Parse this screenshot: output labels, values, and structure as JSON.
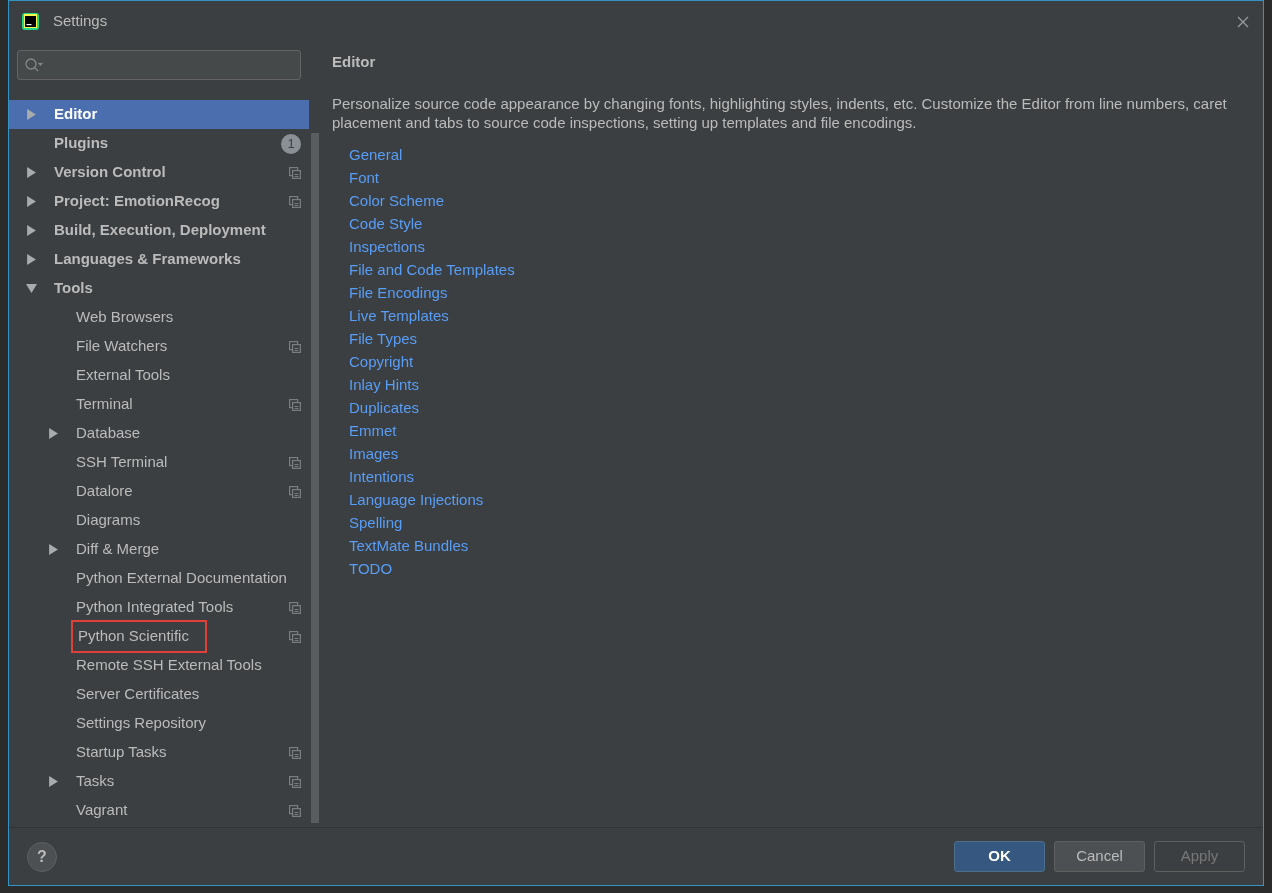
{
  "window": {
    "title": "Settings"
  },
  "sidebar": {
    "items": [
      {
        "label": "Editor",
        "expanded": false,
        "selected": true,
        "project_scoped": false
      },
      {
        "label": "Plugins",
        "selected": false,
        "badge": "1"
      },
      {
        "label": "Version Control",
        "expanded": false,
        "selected": false,
        "project_scoped": true
      },
      {
        "label": "Project: EmotionRecog",
        "expanded": false,
        "selected": false,
        "project_scoped": true
      },
      {
        "label": "Build, Execution, Deployment",
        "expanded": false,
        "selected": false,
        "project_scoped": false
      },
      {
        "label": "Languages & Frameworks",
        "expanded": false,
        "selected": false,
        "project_scoped": false
      },
      {
        "label": "Tools",
        "expanded": true,
        "selected": false,
        "project_scoped": false,
        "children": [
          {
            "label": "Web Browsers",
            "selected": false,
            "project_scoped": false
          },
          {
            "label": "File Watchers",
            "selected": false,
            "project_scoped": true
          },
          {
            "label": "External Tools",
            "selected": false,
            "project_scoped": false
          },
          {
            "label": "Terminal",
            "selected": false,
            "project_scoped": true
          },
          {
            "label": "Database",
            "expanded": false,
            "selected": false,
            "project_scoped": false
          },
          {
            "label": "SSH Terminal",
            "selected": false,
            "project_scoped": true
          },
          {
            "label": "Datalore",
            "selected": false,
            "project_scoped": true
          },
          {
            "label": "Diagrams",
            "selected": false,
            "project_scoped": false
          },
          {
            "label": "Diff & Merge",
            "expanded": false,
            "selected": false,
            "project_scoped": false
          },
          {
            "label": "Python External Documentation",
            "selected": false,
            "project_scoped": false
          },
          {
            "label": "Python Integrated Tools",
            "selected": false,
            "project_scoped": true
          },
          {
            "label": "Python Scientific",
            "selected": false,
            "project_scoped": true,
            "highlighted": true
          },
          {
            "label": "Remote SSH External Tools",
            "selected": false,
            "project_scoped": false
          },
          {
            "label": "Server Certificates",
            "selected": false,
            "project_scoped": false
          },
          {
            "label": "Settings Repository",
            "selected": false,
            "project_scoped": false
          },
          {
            "label": "Startup Tasks",
            "selected": false,
            "project_scoped": true
          },
          {
            "label": "Tasks",
            "expanded": false,
            "selected": false,
            "project_scoped": true
          },
          {
            "label": "Vagrant",
            "selected": false,
            "project_scoped": true
          }
        ]
      }
    ]
  },
  "content": {
    "title": "Editor",
    "description": "Personalize source code appearance by changing fonts, highlighting styles, indents, etc. Customize the Editor from line numbers, caret placement and tabs to source code inspections, setting up templates and file encodings.",
    "links": [
      "General",
      "Font",
      "Color Scheme",
      "Code Style",
      "Inspections",
      "File and Code Templates",
      "File Encodings",
      "Live Templates",
      "File Types",
      "Copyright",
      "Inlay Hints",
      "Duplicates",
      "Emmet",
      "Images",
      "Intentions",
      "Language Injections",
      "Spelling",
      "TextMate Bundles",
      "TODO"
    ]
  },
  "help_button": "?",
  "buttons": [
    {
      "label": "OK",
      "kind": "primary",
      "disabled": false
    },
    {
      "label": "Cancel",
      "kind": "normal",
      "disabled": false
    },
    {
      "label": "Apply",
      "kind": "normal",
      "disabled": true
    }
  ]
}
